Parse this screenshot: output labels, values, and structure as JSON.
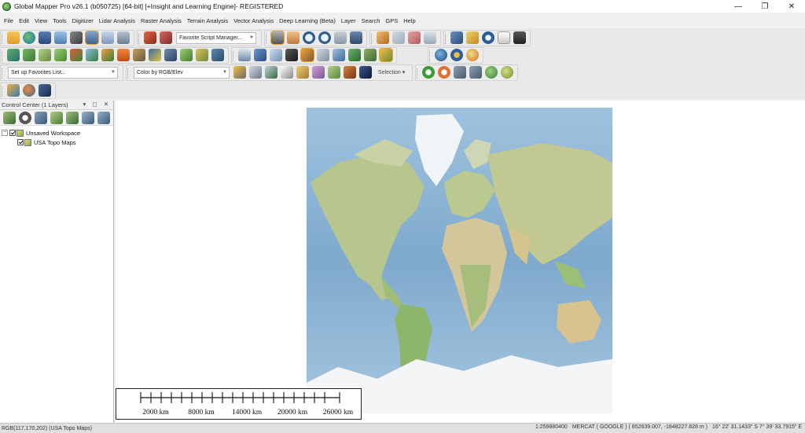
{
  "window": {
    "title": "Global Mapper Pro v26.1 (b050725) [64-bit] [+Insight and Learning Engine]- REGISTERED",
    "minimize": "—",
    "maximize": "❐",
    "close": "✕"
  },
  "menu": [
    "File",
    "Edit",
    "View",
    "Tools",
    "Digitizer",
    "Lidar Analysis",
    "Raster Analysis",
    "Terrain Analysis",
    "Vector Analysis",
    "Deep Learning (Beta)",
    "Layer",
    "Search",
    "GPS",
    "Help"
  ],
  "toolbar": {
    "script_manager": "Favorite Script Manager...",
    "favorites_list": "Set up Favorites List...",
    "color_mode": "Color by RGB/Elev",
    "selection": "Selection"
  },
  "control_center": {
    "title": "Control Center (1 Layers)",
    "header_controls": "▾ ◻ ✕",
    "workspace": "Unsaved Workspace",
    "layer": "USA Topo Maps",
    "expander": "−"
  },
  "scale": {
    "labels": [
      "2000 km",
      "8000 km",
      "14000 km",
      "20000 km",
      "26000 km"
    ]
  },
  "status": {
    "left": "RGB(117,170,202) (USA Topo Maps)",
    "scale": "1:259880400",
    "projection": "MERCAT ( GOOGLE ) ( 852639.007, -1848227.828 m )",
    "latlon": "16° 22' 31.1433\" S 7° 39' 33.7915\" E"
  },
  "colors": {
    "ocean": "#8fb9d9",
    "land": "#b9c98f",
    "ice": "#f4f6f8",
    "accent": "#f0a030"
  }
}
